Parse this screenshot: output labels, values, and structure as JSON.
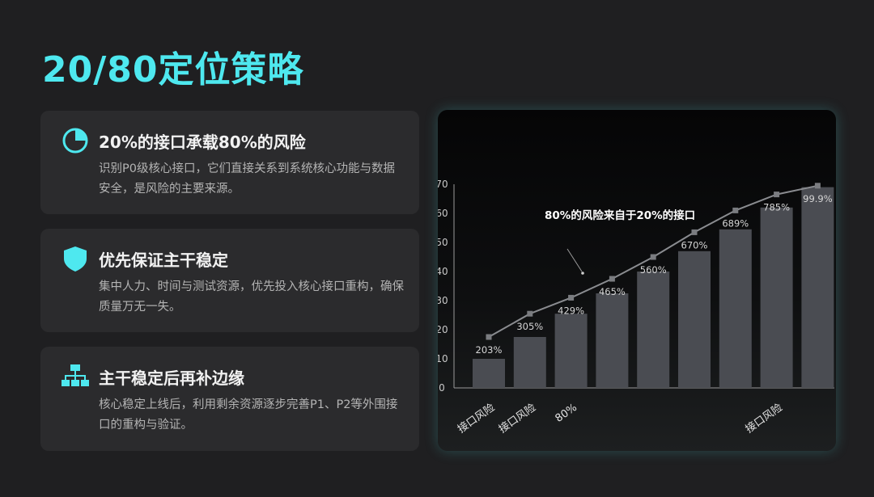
{
  "page": {
    "title": "20/80定位策略"
  },
  "cards": [
    {
      "icon": "pie-chart-icon",
      "title": "20%的接口承载80%的风险",
      "body": "识别P0级核心接口，它们直接关系到系统核心功能与数据安全，是风险的主要来源。"
    },
    {
      "icon": "shield-icon",
      "title": "优先保证主干稳定",
      "body": "集中人力、时间与测试资源，优先投入核心接口重构，确保质量万无一失。"
    },
    {
      "icon": "hierarchy-icon",
      "title": "主干稳定后再补边缘",
      "body": "核心稳定上线后，利用剩余资源逐步完善P1、P2等外围接口的重构与验证。"
    }
  ],
  "colors": {
    "accent": "#4ee8ef",
    "bar": "#4a4c52",
    "line": "#8a8c90",
    "marker": "#7a7c80"
  },
  "chart_data": {
    "type": "bar",
    "bar_values": [
      10,
      17.5,
      25.5,
      32.5,
      40,
      47,
      54.5,
      62,
      69
    ],
    "line_values": [
      17.5,
      25.5,
      31,
      37.5,
      45,
      53.5,
      61,
      66.5,
      69.5
    ],
    "line_labels": [
      "203%",
      "305%",
      "429%",
      "465%",
      "560%",
      "670%",
      "689%",
      "785%",
      "99.9%"
    ],
    "x_labels": [
      "接口风险",
      "接口风险",
      "80%",
      "",
      "",
      "",
      "",
      "接口风险",
      ""
    ],
    "y_ticks": [
      0,
      10,
      20,
      30,
      40,
      50,
      60,
      70
    ],
    "ylim": [
      0,
      70
    ],
    "annotation": "80%的风险来自于20%的接口"
  }
}
